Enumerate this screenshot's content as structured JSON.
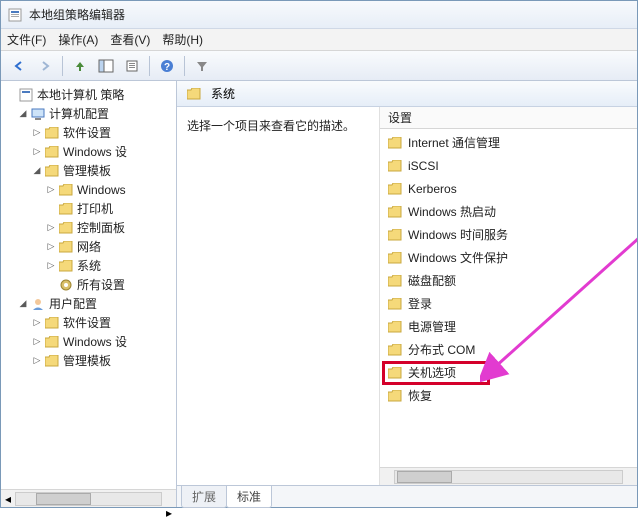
{
  "window": {
    "title": "本地组策略编辑器"
  },
  "menu": {
    "file": "文件(F)",
    "action": "操作(A)",
    "view": "查看(V)",
    "help": "帮助(H)"
  },
  "tree": {
    "root": "本地计算机 策略",
    "computer_config": "计算机配置",
    "software_settings1": "软件设置",
    "windows_settings1": "Windows 设",
    "admin_templates1": "管理模板",
    "windows": "Windows",
    "printer": "打印机",
    "control_panel": "控制面板",
    "network": "网络",
    "system": "系统",
    "all_settings": "所有设置",
    "user_config": "用户配置",
    "software_settings2": "软件设置",
    "windows_settings2": "Windows 设",
    "admin_templates2": "管理模板"
  },
  "right": {
    "header": "系统",
    "description": "选择一个项目来查看它的描述。",
    "column_header": "设置",
    "items": [
      "Internet 通信管理",
      "iSCSI",
      "Kerberos",
      "Windows 热启动",
      "Windows 时间服务",
      "Windows 文件保护",
      "磁盘配额",
      "登录",
      "电源管理",
      "分布式 COM",
      "关机选项",
      "恢复"
    ]
  },
  "tabs": {
    "extend": "扩展",
    "standard": "标准"
  }
}
